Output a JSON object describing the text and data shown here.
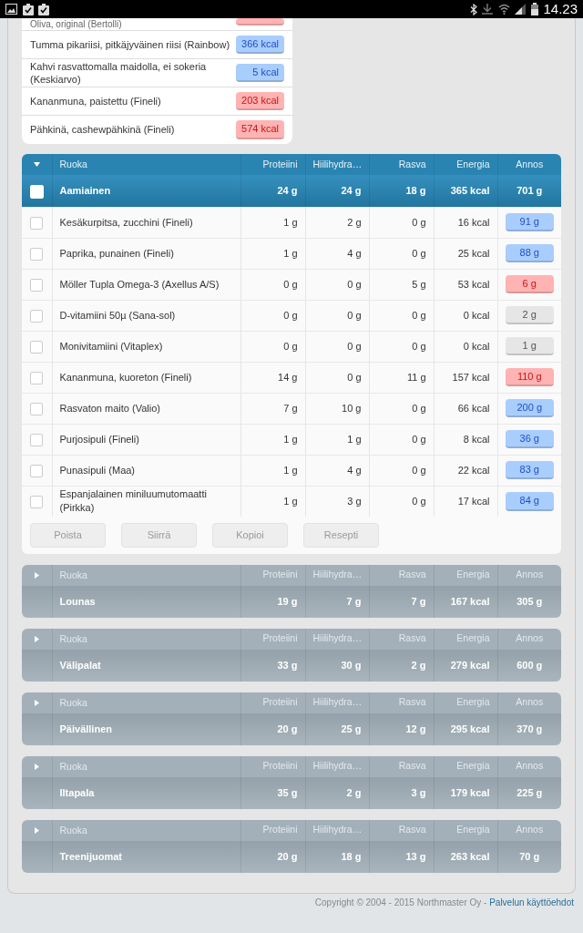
{
  "status_bar": {
    "time": "14.23"
  },
  "food_list": [
    {
      "name": "Oliva, original (Bertolli)",
      "color": "#ffb3b3"
    },
    {
      "name": "Tumma pikariisi, pitkäjyväinen riisi (Rainbow)",
      "kcal": "366 kcal",
      "color": "#a9cdfc"
    },
    {
      "name": "Kahvi rasvattomalla maidolla, ei sokeria (Keskiarvo)",
      "kcal": "5 kcal",
      "color": "#a9cdfc"
    },
    {
      "name": "Kananmuna, paistettu (Fineli)",
      "kcal": "203 kcal",
      "color": "#ffb3b3"
    },
    {
      "name": "Pähkinä, cashewpähkinä (Fineli)",
      "kcal": "574 kcal",
      "color": "#ffb3b3"
    }
  ],
  "meals": [
    {
      "columns": [
        "Ruoka",
        "Proteiini",
        "Hiilihydra…",
        "Rasva",
        "Energia",
        "Annos"
      ],
      "name": "Aamiainen",
      "expanded": true,
      "checked": false,
      "protein": "24 g",
      "carbs": "24 g",
      "fat": "18 g",
      "energy": "365 kcal",
      "serving": "701 g",
      "items": [
        {
          "name": "Kesäkurpitsa, zucchini (Fineli)",
          "checked": false,
          "protein": "1 g",
          "carbs": "2 g",
          "fat": "0 g",
          "energy": "16 kcal",
          "serving": "91 g",
          "color": "#a9cdfc"
        },
        {
          "name": "Paprika, punainen (Fineli)",
          "checked": false,
          "protein": "1 g",
          "carbs": "4 g",
          "fat": "0 g",
          "energy": "25 kcal",
          "serving": "88 g",
          "color": "#a9cdfc"
        },
        {
          "name": "Möller Tupla Omega-3 (Axellus A/S)",
          "checked": false,
          "protein": "0 g",
          "carbs": "0 g",
          "fat": "5 g",
          "energy": "53 kcal",
          "serving": "6 g",
          "color": "#ffb3b3"
        },
        {
          "name": "D-vitamiini 50µ (Sana-sol)",
          "checked": false,
          "protein": "0 g",
          "carbs": "0 g",
          "fat": "0 g",
          "energy": "0 kcal",
          "serving": "2 g",
          "color": "#e6e6e6"
        },
        {
          "name": "Monivitamiini (Vitaplex)",
          "checked": false,
          "protein": "0 g",
          "carbs": "0 g",
          "fat": "0 g",
          "energy": "0 kcal",
          "serving": "1 g",
          "color": "#e6e6e6"
        },
        {
          "name": "Kananmuna, kuoreton (Fineli)",
          "checked": false,
          "protein": "14 g",
          "carbs": "0 g",
          "fat": "11 g",
          "energy": "157 kcal",
          "serving": "110 g",
          "color": "#ffb3b3"
        },
        {
          "name": "Rasvaton maito (Valio)",
          "checked": false,
          "protein": "7 g",
          "carbs": "10 g",
          "fat": "0 g",
          "energy": "66 kcal",
          "serving": "200 g",
          "color": "#a9cdfc"
        },
        {
          "name": "Purjosipuli (Fineli)",
          "checked": false,
          "protein": "1 g",
          "carbs": "1 g",
          "fat": "0 g",
          "energy": "8 kcal",
          "serving": "36 g",
          "color": "#a9cdfc"
        },
        {
          "name": "Punasipuli (Maa)",
          "checked": false,
          "protein": "1 g",
          "carbs": "4 g",
          "fat": "0 g",
          "energy": "22 kcal",
          "serving": "83 g",
          "color": "#a9cdfc"
        },
        {
          "name": "Espanjalainen miniluumutomaatti (Pirkka)",
          "checked": false,
          "protein": "1 g",
          "carbs": "3 g",
          "fat": "0 g",
          "energy": "17 kcal",
          "serving": "84 g",
          "color": "#a9cdfc"
        }
      ],
      "buttons": [
        "Poista",
        "Siirrä",
        "Kopioi",
        "Resepti"
      ]
    },
    {
      "columns": [
        "Ruoka",
        "Proteiini",
        "Hiilihydra…",
        "Rasva",
        "Energia",
        "Annos"
      ],
      "name": "Lounas",
      "expanded": false,
      "protein": "19 g",
      "carbs": "7 g",
      "fat": "7 g",
      "energy": "167 kcal",
      "serving": "305 g"
    },
    {
      "columns": [
        "Ruoka",
        "Proteiini",
        "Hiilihydra…",
        "Rasva",
        "Energia",
        "Annos"
      ],
      "name": "Välipalat",
      "expanded": false,
      "protein": "33 g",
      "carbs": "30 g",
      "fat": "2 g",
      "energy": "279 kcal",
      "serving": "600 g"
    },
    {
      "columns": [
        "Ruoka",
        "Proteiini",
        "Hiilihydra…",
        "Rasva",
        "Energia",
        "Annos"
      ],
      "name": "Päivällinen",
      "expanded": false,
      "protein": "20 g",
      "carbs": "25 g",
      "fat": "12 g",
      "energy": "295 kcal",
      "serving": "370 g"
    },
    {
      "columns": [
        "Ruoka",
        "Proteiini",
        "Hiilihydra…",
        "Rasva",
        "Energia",
        "Annos"
      ],
      "name": "Iltapala",
      "expanded": false,
      "protein": "35 g",
      "carbs": "2 g",
      "fat": "3 g",
      "energy": "179 kcal",
      "serving": "225 g"
    },
    {
      "columns": [
        "Ruoka",
        "Proteiini",
        "Hiilihydra…",
        "Rasva",
        "Energia",
        "Annos"
      ],
      "name": "Treenijuomat",
      "expanded": false,
      "protein": "20 g",
      "carbs": "18 g",
      "fat": "13 g",
      "energy": "263 kcal",
      "serving": "70 g"
    }
  ],
  "footer": {
    "copyright": "Copyright © 2004 - 2015 Northmaster Oy -",
    "link": "Palvelun käyttöehdot"
  }
}
